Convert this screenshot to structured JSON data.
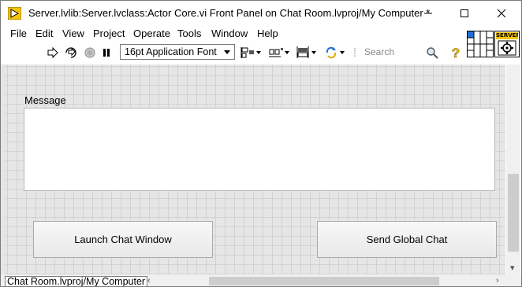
{
  "window": {
    "title": "Server.lvlib:Server.lvclass:Actor Core.vi Front Panel on Chat Room.lvproj/My Computer *"
  },
  "menu": [
    "File",
    "Edit",
    "View",
    "Project",
    "Operate",
    "Tools",
    "Window",
    "Help"
  ],
  "toolbar": {
    "font": "16pt Application Font",
    "search_placeholder": "Search"
  },
  "icon": {
    "badge": "SERVER"
  },
  "panel": {
    "message_label": "Message",
    "message_value": "",
    "buttons": {
      "launch": "Launch Chat Window",
      "send": "Send Global Chat"
    }
  },
  "status": {
    "context": "Chat Room.lvproj/My Computer"
  },
  "colors": {
    "grid_bg": "#e6e6e6",
    "grid_line": "#d2d2d2",
    "icon_badge_bg": "#f5c400",
    "connector_selected": "#1e6fd9"
  }
}
